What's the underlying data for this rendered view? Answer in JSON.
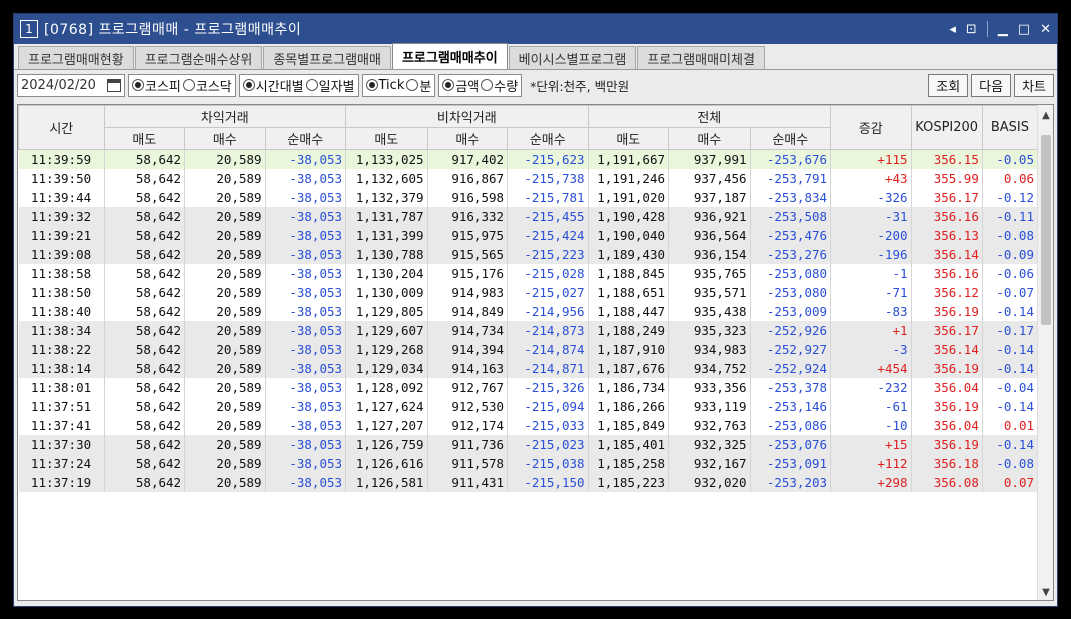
{
  "window": {
    "number": "1",
    "title": "[0768] 프로그램매매 - 프로그램매매추이"
  },
  "tabs": [
    {
      "label": "프로그램매매현황",
      "active": false
    },
    {
      "label": "프로그램순매수상위",
      "active": false
    },
    {
      "label": "종목별프로그램매매",
      "active": false
    },
    {
      "label": "프로그램매매추이",
      "active": true
    },
    {
      "label": "베이시스별프로그램",
      "active": false
    },
    {
      "label": "프로그램매매미체결",
      "active": false
    }
  ],
  "toolbar": {
    "date": "2024/02/20",
    "market": {
      "kospi": "코스피",
      "kosdaq": "코스닥",
      "selected": "kospi"
    },
    "period": {
      "time": "시간대별",
      "day": "일자별",
      "selected": "time"
    },
    "interval": {
      "tick": "Tick",
      "min": "분",
      "selected": "tick"
    },
    "measure": {
      "amount": "금액",
      "qty": "수량",
      "selected": "amount"
    },
    "unit_text": "*단위:천주, 백만원",
    "query_label": "조회",
    "next_label": "다음",
    "chart_label": "차트"
  },
  "table": {
    "headers": {
      "time": "시간",
      "arb": "차익거래",
      "nonarb": "비차익거래",
      "total": "전체",
      "change": "증감",
      "kospi": "KOSPI200",
      "basis": "BASIS",
      "sell": "매도",
      "buy": "매수",
      "net": "순매수"
    },
    "rows": [
      [
        "11:39:59",
        "58,642",
        "20,589",
        "-38,053",
        "1,133,025",
        "917,402",
        "-215,623",
        "1,191,667",
        "937,991",
        "-253,676",
        "+115",
        "356.15",
        "-0.05"
      ],
      [
        "11:39:50",
        "58,642",
        "20,589",
        "-38,053",
        "1,132,605",
        "916,867",
        "-215,738",
        "1,191,246",
        "937,456",
        "-253,791",
        "+43",
        "355.99",
        "0.06"
      ],
      [
        "11:39:44",
        "58,642",
        "20,589",
        "-38,053",
        "1,132,379",
        "916,598",
        "-215,781",
        "1,191,020",
        "937,187",
        "-253,834",
        "-326",
        "356.17",
        "-0.12"
      ],
      [
        "11:39:32",
        "58,642",
        "20,589",
        "-38,053",
        "1,131,787",
        "916,332",
        "-215,455",
        "1,190,428",
        "936,921",
        "-253,508",
        "-31",
        "356.16",
        "-0.11"
      ],
      [
        "11:39:21",
        "58,642",
        "20,589",
        "-38,053",
        "1,131,399",
        "915,975",
        "-215,424",
        "1,190,040",
        "936,564",
        "-253,476",
        "-200",
        "356.13",
        "-0.08"
      ],
      [
        "11:39:08",
        "58,642",
        "20,589",
        "-38,053",
        "1,130,788",
        "915,565",
        "-215,223",
        "1,189,430",
        "936,154",
        "-253,276",
        "-196",
        "356.14",
        "-0.09"
      ],
      [
        "11:38:58",
        "58,642",
        "20,589",
        "-38,053",
        "1,130,204",
        "915,176",
        "-215,028",
        "1,188,845",
        "935,765",
        "-253,080",
        "-1",
        "356.16",
        "-0.06"
      ],
      [
        "11:38:50",
        "58,642",
        "20,589",
        "-38,053",
        "1,130,009",
        "914,983",
        "-215,027",
        "1,188,651",
        "935,571",
        "-253,080",
        "-71",
        "356.12",
        "-0.07"
      ],
      [
        "11:38:40",
        "58,642",
        "20,589",
        "-38,053",
        "1,129,805",
        "914,849",
        "-214,956",
        "1,188,447",
        "935,438",
        "-253,009",
        "-83",
        "356.19",
        "-0.14"
      ],
      [
        "11:38:34",
        "58,642",
        "20,589",
        "-38,053",
        "1,129,607",
        "914,734",
        "-214,873",
        "1,188,249",
        "935,323",
        "-252,926",
        "+1",
        "356.17",
        "-0.17"
      ],
      [
        "11:38:22",
        "58,642",
        "20,589",
        "-38,053",
        "1,129,268",
        "914,394",
        "-214,874",
        "1,187,910",
        "934,983",
        "-252,927",
        "-3",
        "356.14",
        "-0.14"
      ],
      [
        "11:38:14",
        "58,642",
        "20,589",
        "-38,053",
        "1,129,034",
        "914,163",
        "-214,871",
        "1,187,676",
        "934,752",
        "-252,924",
        "+454",
        "356.19",
        "-0.14"
      ],
      [
        "11:38:01",
        "58,642",
        "20,589",
        "-38,053",
        "1,128,092",
        "912,767",
        "-215,326",
        "1,186,734",
        "933,356",
        "-253,378",
        "-232",
        "356.04",
        "-0.04"
      ],
      [
        "11:37:51",
        "58,642",
        "20,589",
        "-38,053",
        "1,127,624",
        "912,530",
        "-215,094",
        "1,186,266",
        "933,119",
        "-253,146",
        "-61",
        "356.19",
        "-0.14"
      ],
      [
        "11:37:41",
        "58,642",
        "20,589",
        "-38,053",
        "1,127,207",
        "912,174",
        "-215,033",
        "1,185,849",
        "932,763",
        "-253,086",
        "-10",
        "356.04",
        "0.01"
      ],
      [
        "11:37:30",
        "58,642",
        "20,589",
        "-38,053",
        "1,126,759",
        "911,736",
        "-215,023",
        "1,185,401",
        "932,325",
        "-253,076",
        "+15",
        "356.19",
        "-0.14"
      ],
      [
        "11:37:24",
        "58,642",
        "20,589",
        "-38,053",
        "1,126,616",
        "911,578",
        "-215,038",
        "1,185,258",
        "932,167",
        "-253,091",
        "+112",
        "356.18",
        "-0.08"
      ],
      [
        "11:37:19",
        "58,642",
        "20,589",
        "-38,053",
        "1,126,581",
        "911,431",
        "-215,150",
        "1,185,223",
        "932,020",
        "-253,203",
        "+298",
        "356.08",
        "0.07"
      ]
    ],
    "row_shading": [
      "sel",
      "even",
      "even",
      "odd",
      "odd",
      "odd",
      "even",
      "even",
      "even",
      "odd",
      "odd",
      "odd",
      "even",
      "even",
      "even",
      "odd",
      "odd",
      "odd"
    ]
  },
  "colors": {
    "title_bar": "#2d4e8f",
    "negative": "#2a4fd8",
    "positive": "#e02020",
    "selected_row": "#eaf6dc"
  }
}
